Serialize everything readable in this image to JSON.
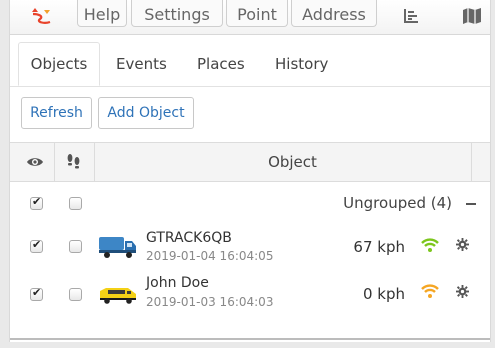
{
  "toolbar": {
    "logo_icon": "route-logo-icon",
    "buttons": [
      "Help",
      "Settings",
      "Point",
      "Address"
    ],
    "icons": [
      "chart-icon",
      "map-icon"
    ]
  },
  "tabs": [
    "Objects",
    "Events",
    "Places",
    "History"
  ],
  "actions": {
    "refresh": "Refresh",
    "add_object": "Add Object"
  },
  "table": {
    "header": {
      "visibility_icon": "eye-icon",
      "follow_icon": "footsteps-icon",
      "object": "Object"
    },
    "group": {
      "label": "Ungrouped (4)",
      "visible_checked": true,
      "follow_checked": false
    },
    "objects": [
      {
        "name": "GTRACK6QB",
        "time": "2019-01-04 16:04:05",
        "speed": "67 kph",
        "vehicle_icon": "truck-icon",
        "signal_color": "#7cc61d",
        "visible_checked": true,
        "follow_checked": false
      },
      {
        "name": "John Doe",
        "time": "2019-01-03 16:04:03",
        "speed": "0 kph",
        "vehicle_icon": "van-icon",
        "signal_color": "#f5a623",
        "visible_checked": true,
        "follow_checked": false
      }
    ]
  }
}
